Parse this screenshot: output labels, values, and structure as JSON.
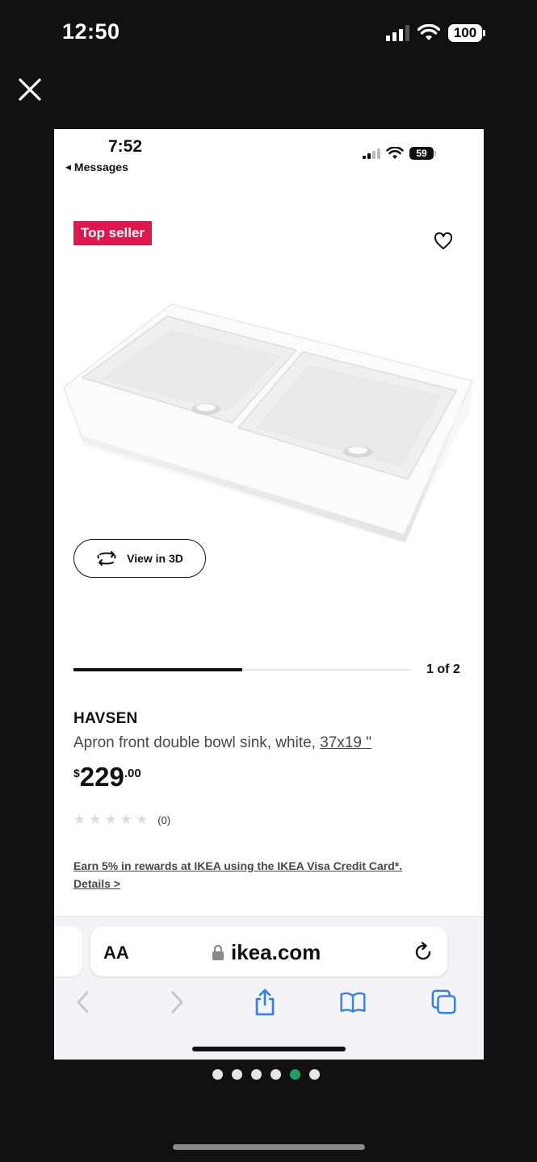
{
  "outer_status": {
    "time": "12:50",
    "battery": "100"
  },
  "close_icon": "close-icon",
  "inner_status": {
    "time": "7:52",
    "back_label": "Messages",
    "battery": "59"
  },
  "product": {
    "badge": "Top seller",
    "view_3d_label": "View in 3D",
    "image_counter": "1 of 2",
    "image_progress": 0.5,
    "name": "HAVSEN",
    "description": "Apron front double bowl sink, white,",
    "size": "37x19 \"",
    "price": {
      "currency": "$",
      "dollars": "229",
      "cents": ".00"
    },
    "rating_count": "(0)",
    "stars_filled": 0,
    "promo_line1": "Earn 5% in rewards at IKEA using the IKEA Visa Credit Card*.",
    "promo_line2": "Details >"
  },
  "safari": {
    "text_size_label": "AA",
    "domain": "ikea.com"
  },
  "page_dots": {
    "count": 6,
    "active_index": 4
  },
  "colors": {
    "badge": "#e0164f",
    "active_dot": "#1f9e6a",
    "link_blue": "#2f7df6"
  }
}
